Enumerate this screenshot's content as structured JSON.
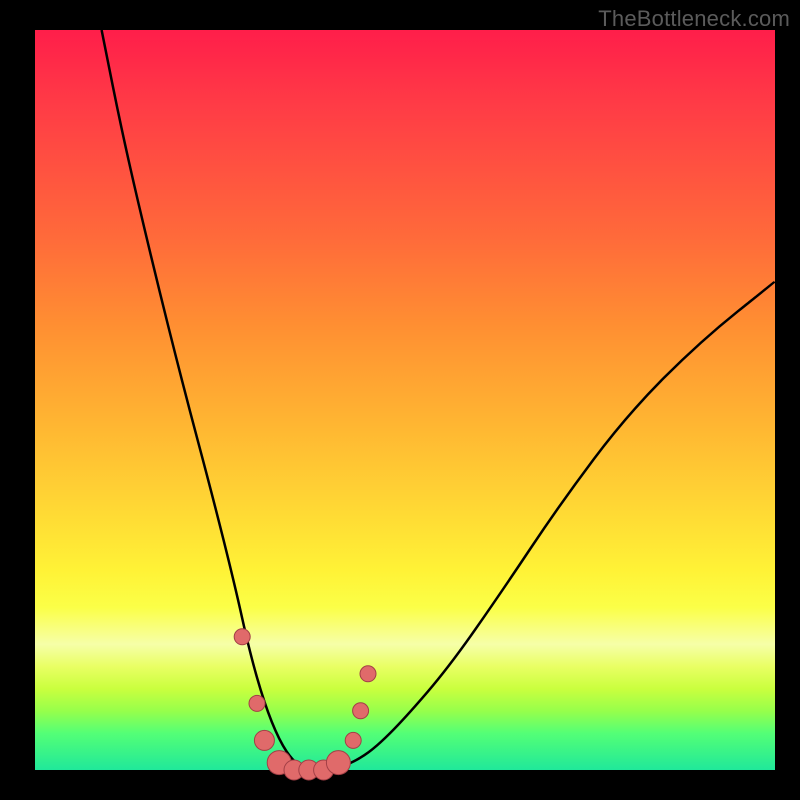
{
  "watermark": "TheBottleneck.com",
  "colors": {
    "frame": "#000000",
    "gradient_top": "#ff1e4a",
    "gradient_mid": "#ffd634",
    "gradient_bottom": "#20e89a",
    "curve": "#000000",
    "dot_fill": "#e06a6a",
    "dot_stroke": "#a23f46"
  },
  "chart_data": {
    "type": "line",
    "title": "",
    "xlabel": "",
    "ylabel": "",
    "xlim": [
      0,
      100
    ],
    "ylim": [
      0,
      100
    ],
    "series": [
      {
        "name": "bottleneck-curve",
        "x": [
          9,
          12,
          16,
          20,
          24,
          27,
          29,
          31,
          33,
          35,
          37,
          40,
          43,
          46,
          50,
          56,
          63,
          71,
          80,
          90,
          100
        ],
        "y": [
          100,
          85,
          68,
          52,
          37,
          25,
          16,
          9,
          4,
          1,
          0,
          0,
          1,
          3,
          7,
          14,
          24,
          36,
          48,
          58,
          66
        ]
      }
    ],
    "markers": {
      "name": "highlight-dots",
      "x": [
        28,
        30,
        31,
        33,
        35,
        37,
        39,
        41,
        43,
        44,
        45
      ],
      "y": [
        18,
        9,
        4,
        1,
        0,
        0,
        0,
        1,
        4,
        8,
        13
      ],
      "r": [
        8,
        8,
        10,
        12,
        10,
        10,
        10,
        12,
        8,
        8,
        8
      ]
    }
  }
}
